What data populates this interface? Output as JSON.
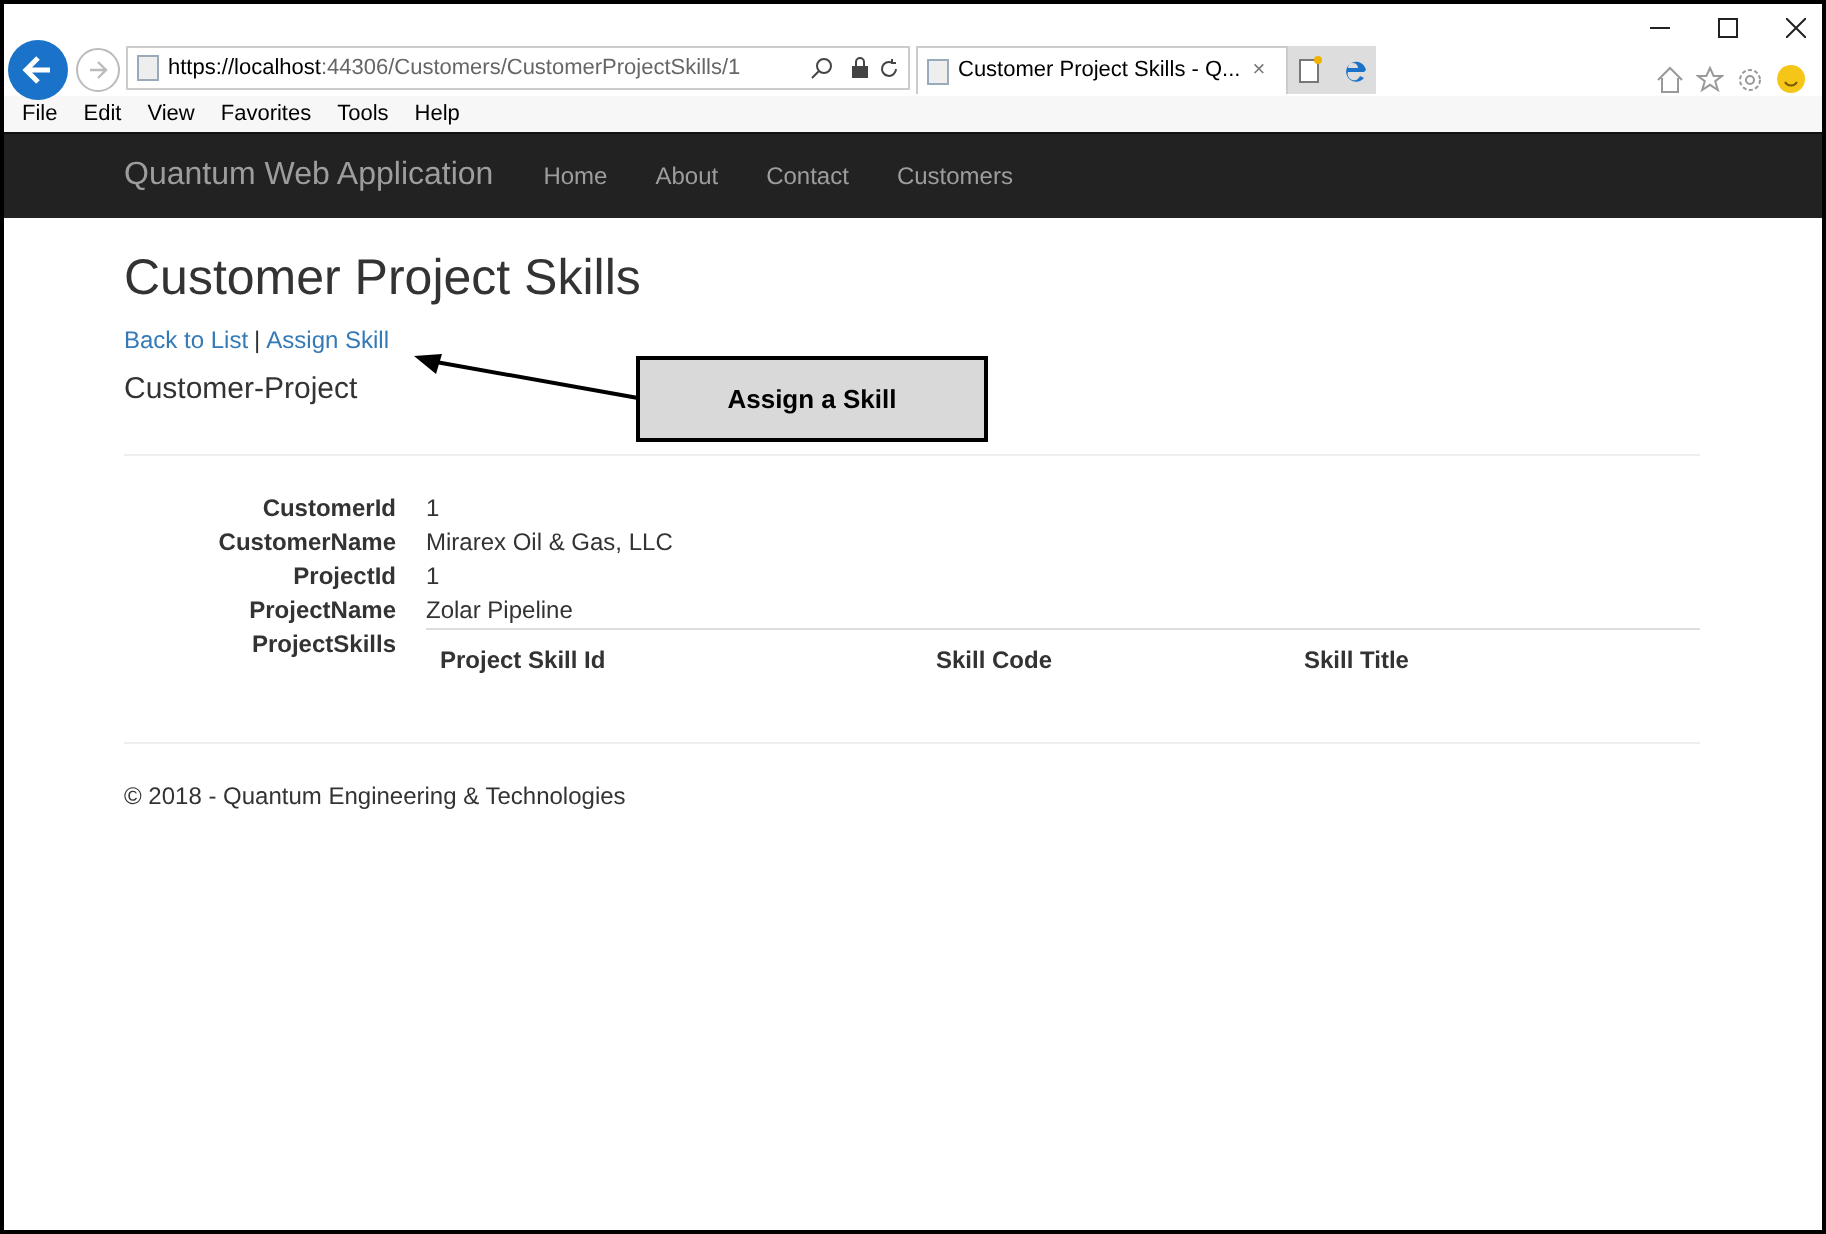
{
  "browser": {
    "address_host": "https://localhost",
    "address_path": ":44306/Customers/CustomerProjectSkills/1",
    "tab_title": "Customer Project Skills - Q...",
    "tab_close": "×"
  },
  "menu": [
    "File",
    "Edit",
    "View",
    "Favorites",
    "Tools",
    "Help"
  ],
  "navbar": {
    "brand": "Quantum Web Application",
    "links": [
      "Home",
      "About",
      "Contact",
      "Customers"
    ]
  },
  "page": {
    "title": "Customer Project Skills",
    "links": [
      "Back to List",
      "Assign Skill"
    ],
    "separator": "|",
    "subtitle": "Customer-Project",
    "details": [
      {
        "label": "CustomerId",
        "value": "1"
      },
      {
        "label": "CustomerName",
        "value": "Mirarex Oil & Gas, LLC"
      },
      {
        "label": "ProjectId",
        "value": "1"
      },
      {
        "label": "ProjectName",
        "value": "Zolar Pipeline"
      }
    ],
    "skills_label": "ProjectSkills",
    "table": {
      "columns": [
        "Project Skill Id",
        "Skill Code",
        "Skill Title"
      ]
    }
  },
  "footer": "© 2018 - Quantum Engineering & Technologies",
  "callout": {
    "text": "Assign a Skill"
  }
}
